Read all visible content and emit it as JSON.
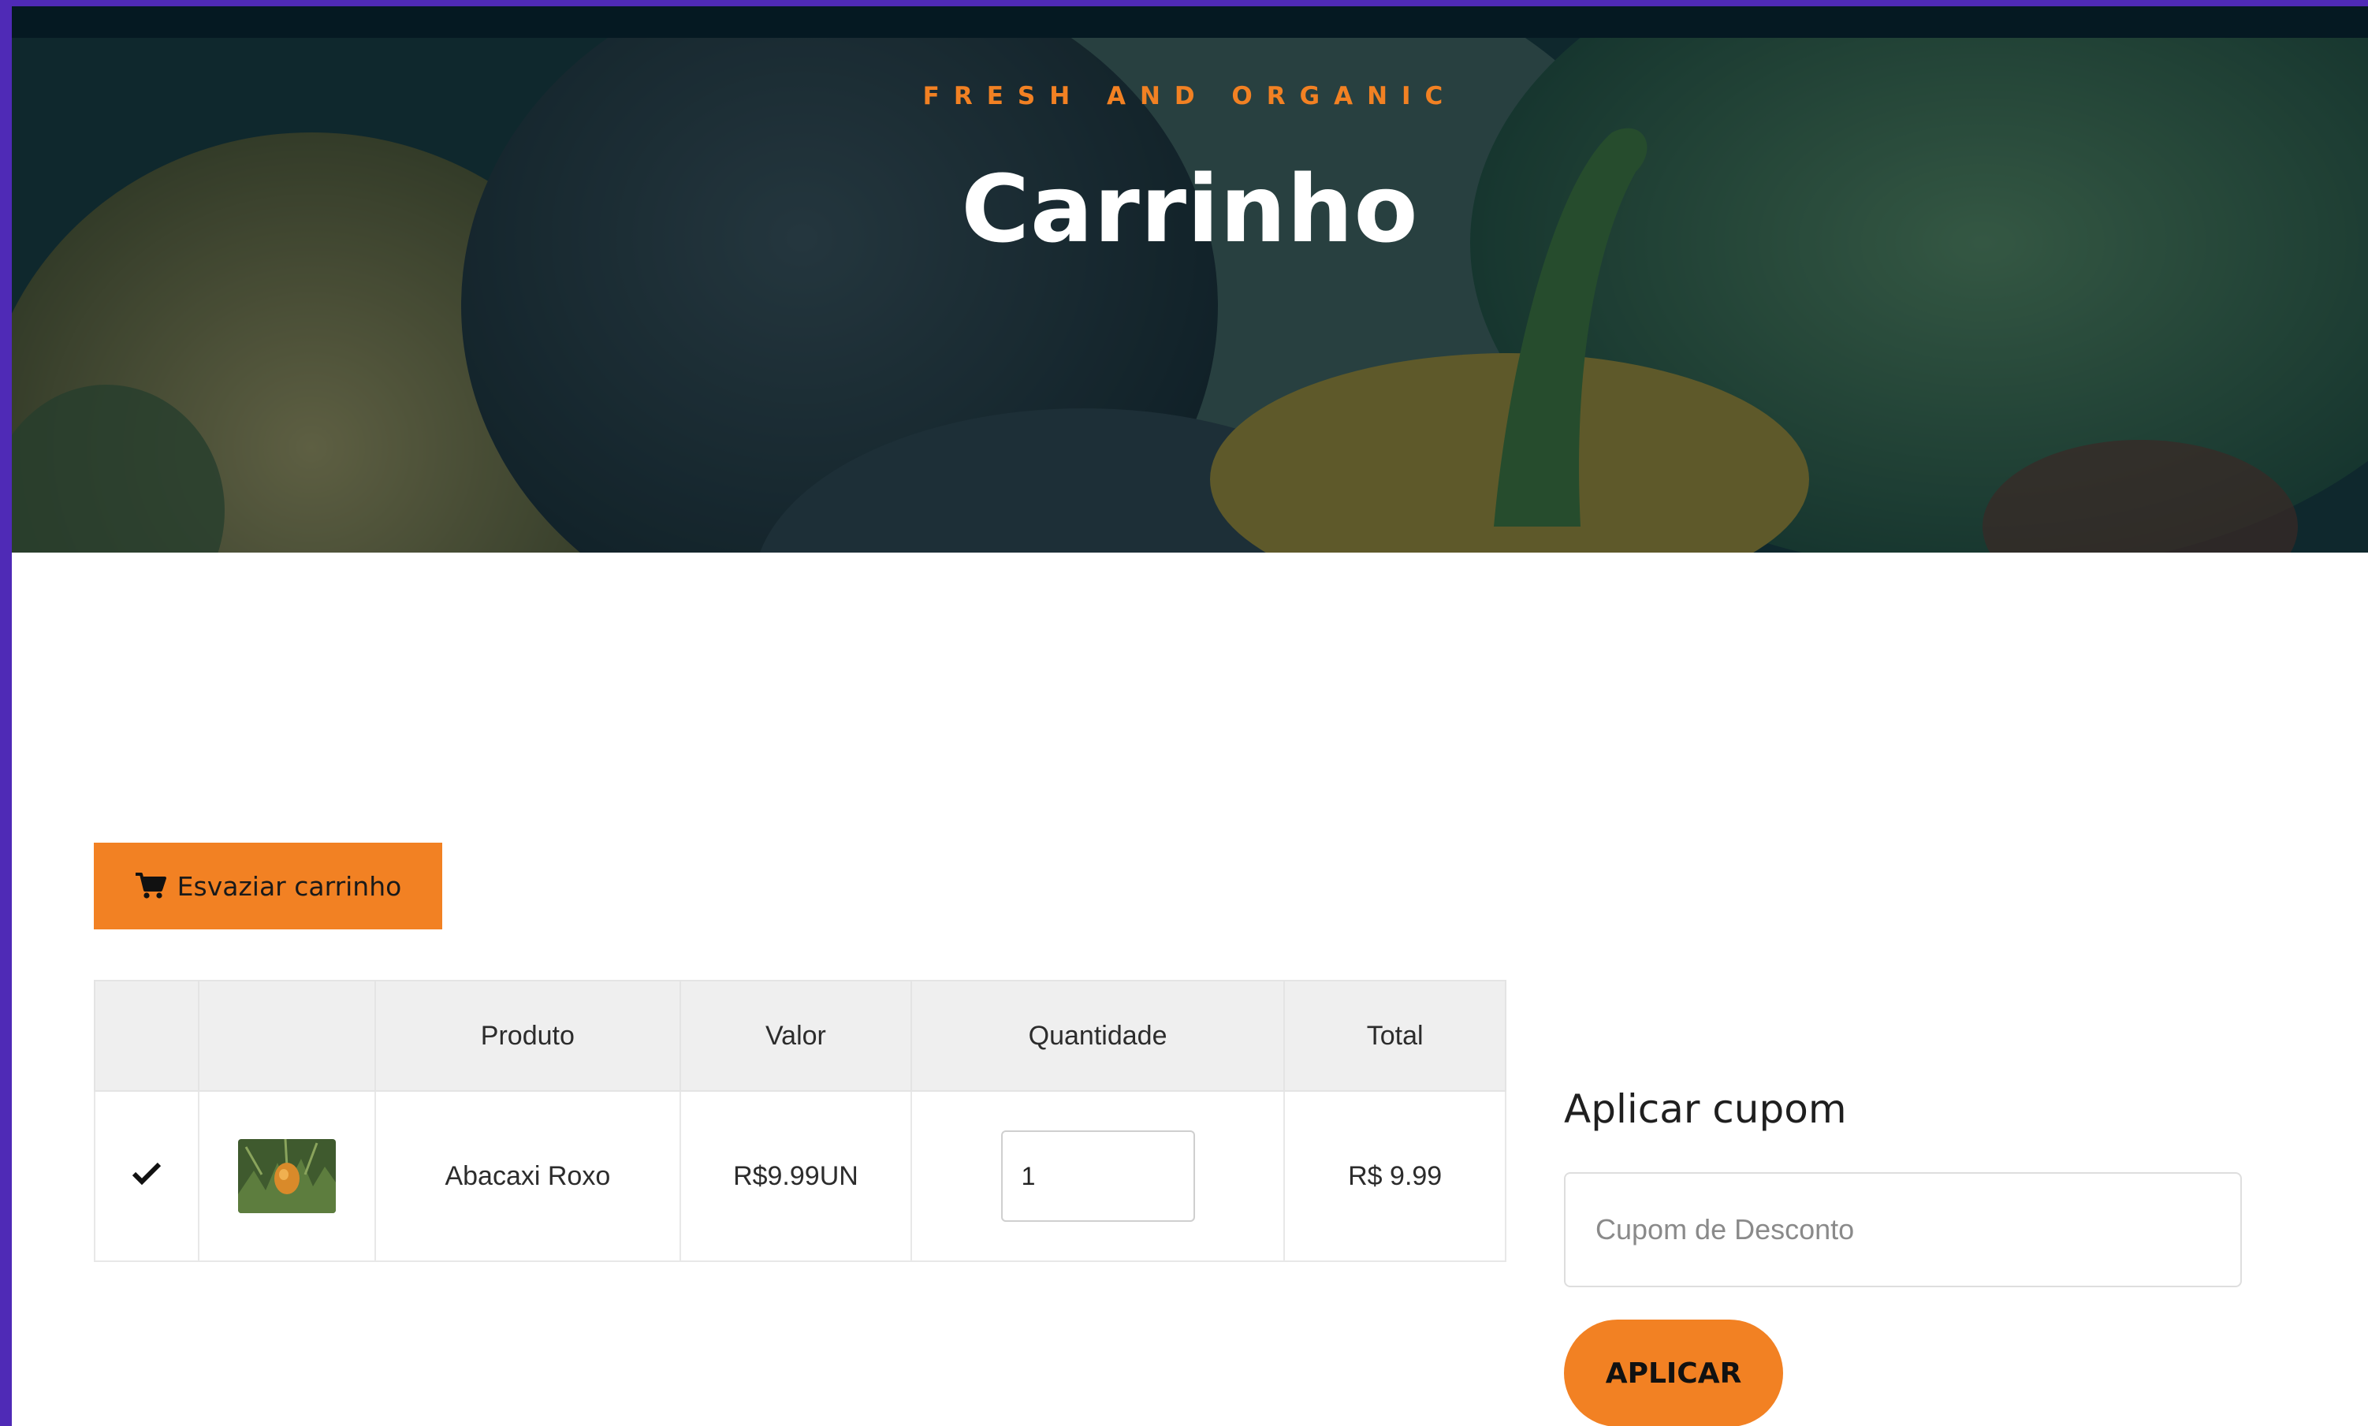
{
  "hero": {
    "subtitle": "FRESH AND ORGANIC",
    "title": "Carrinho"
  },
  "actions": {
    "empty_cart_label": "Esvaziar carrinho",
    "empty_cart_icon": "cart-icon"
  },
  "cart_table": {
    "headers": [
      "",
      "",
      "Produto",
      "Valor",
      "Quantidade",
      "Total"
    ],
    "rows": [
      {
        "selected_icon": "check-icon",
        "image": "pineapple-thumbnail",
        "product": "Abacaxi Roxo",
        "price": "R$9.99UN",
        "quantity": "1",
        "total": "R$ 9.99"
      }
    ]
  },
  "coupon": {
    "title": "Aplicar cupom",
    "placeholder": "Cupom de Desconto",
    "button_label": "APLICAR"
  },
  "colors": {
    "accent": "#f28123",
    "frame": "#4f2ab6",
    "topbar": "#051922"
  }
}
